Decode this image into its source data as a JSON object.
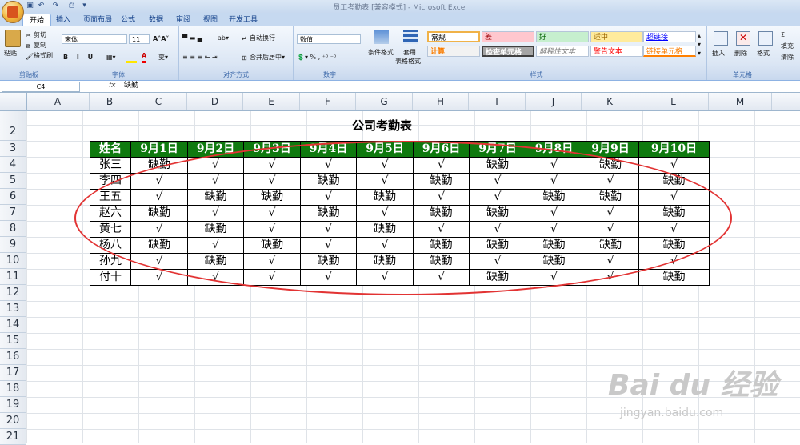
{
  "window_title": "员工考勤表 [兼容模式] - Microsoft Excel",
  "tabs": [
    "开始",
    "插入",
    "页面布局",
    "公式",
    "数据",
    "审阅",
    "视图",
    "开发工具"
  ],
  "active_tab": "开始",
  "clipboard": {
    "paste": "粘贴",
    "cut": "剪切",
    "copy": "复制",
    "format_painter": "格式刷",
    "label": "剪贴板"
  },
  "font": {
    "name": "宋体",
    "size": "11",
    "label": "字体"
  },
  "alignment": {
    "wrap": "自动换行",
    "merge": "合并后居中",
    "label": "对齐方式"
  },
  "number": {
    "format": "数值",
    "label": "数字"
  },
  "styles": {
    "conditional": "条件格式",
    "table_format": "套用",
    "table_format2": "表格格式",
    "cells": [
      "常规",
      "差",
      "好",
      "适中",
      "超链接",
      "计算",
      "检查单元格",
      "解释性文本",
      "警告文本",
      "链接单元格"
    ],
    "label": "样式"
  },
  "cells_group": {
    "insert": "插入",
    "delete": "删除",
    "format": "格式",
    "label": "单元格"
  },
  "editing": {
    "sum": "Σ",
    "fill": "填充",
    "clear": "清除"
  },
  "formula_bar": {
    "name_box": "C4",
    "fx": "fx",
    "content": "缺勤"
  },
  "columns": [
    "A",
    "B",
    "C",
    "D",
    "E",
    "F",
    "G",
    "H",
    "I",
    "J",
    "K",
    "L",
    "M"
  ],
  "rows": [
    "2",
    "3",
    "4",
    "5",
    "6",
    "7",
    "8",
    "9",
    "10",
    "11",
    "12",
    "13",
    "14",
    "15",
    "16",
    "17",
    "18",
    "19",
    "20",
    "21"
  ],
  "sheet": {
    "title": "公司考勤表",
    "header": [
      "姓名",
      "9月1日",
      "9月2日",
      "9月3日",
      "9月4日",
      "9月5日",
      "9月6日",
      "9月7日",
      "9月8日",
      "9月9日",
      "9月10日"
    ],
    "rows": [
      [
        "张三",
        "缺勤",
        "√",
        "√",
        "√",
        "√",
        "√",
        "缺勤",
        "√",
        "缺勤",
        "√"
      ],
      [
        "李四",
        "√",
        "√",
        "√",
        "缺勤",
        "√",
        "缺勤",
        "√",
        "√",
        "√",
        "缺勤"
      ],
      [
        "王五",
        "√",
        "缺勤",
        "缺勤",
        "√",
        "缺勤",
        "√",
        "√",
        "缺勤",
        "缺勤",
        "√"
      ],
      [
        "赵六",
        "缺勤",
        "√",
        "√",
        "缺勤",
        "√",
        "缺勤",
        "缺勤",
        "√",
        "√",
        "缺勤"
      ],
      [
        "黄七",
        "√",
        "缺勤",
        "√",
        "√",
        "缺勤",
        "√",
        "√",
        "√",
        "√",
        "√"
      ],
      [
        "杨八",
        "缺勤",
        "√",
        "缺勤",
        "√",
        "√",
        "缺勤",
        "缺勤",
        "缺勤",
        "缺勤",
        "缺勤"
      ],
      [
        "孙九",
        "√",
        "缺勤",
        "√",
        "缺勤",
        "缺勤",
        "缺勤",
        "√",
        "缺勤",
        "√",
        "√"
      ],
      [
        "付十",
        "√",
        "√",
        "√",
        "√",
        "√",
        "√",
        "缺勤",
        "√",
        "√",
        "缺勤"
      ]
    ]
  },
  "watermark": {
    "brand": "Bai du 经验",
    "url": "jingyan.baidu.com"
  },
  "colors": {
    "header_bg": "#0f7a0f",
    "annotation": "#e23333"
  }
}
